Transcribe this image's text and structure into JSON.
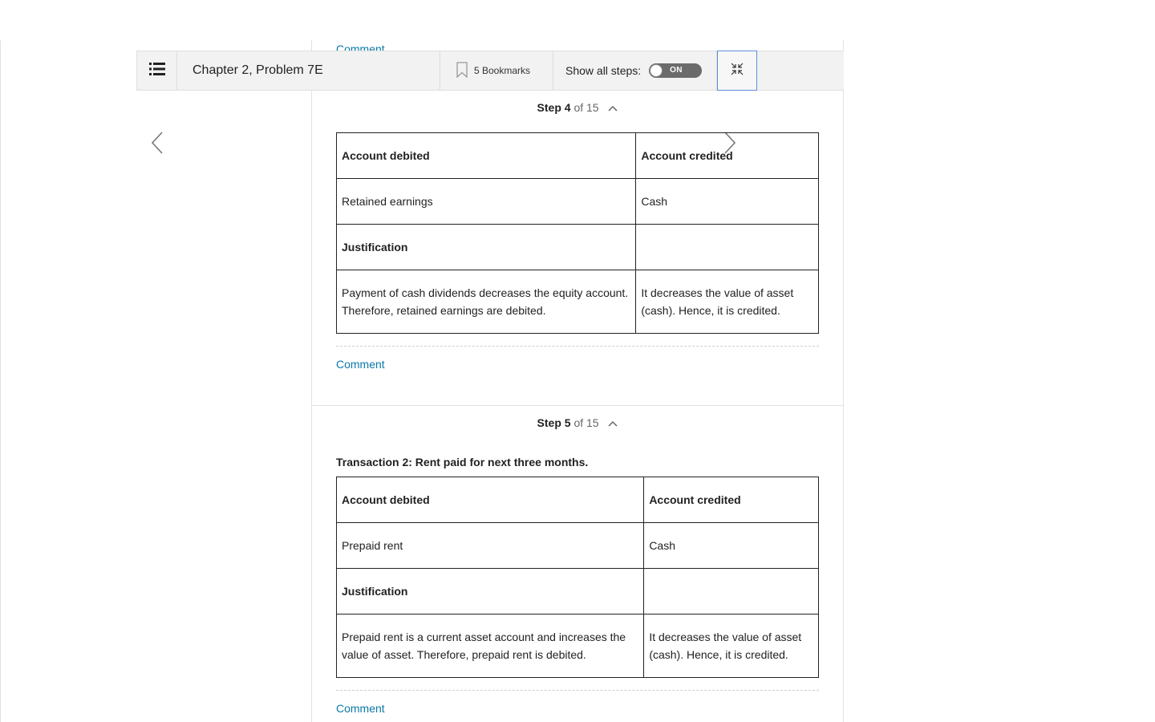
{
  "toolbar": {
    "title": "Chapter 2, Problem 7E",
    "bookmarks_label": "5 Bookmarks",
    "show_all_steps_label": "Show all steps:",
    "toggle_label": "ON"
  },
  "top_comment": "Comment",
  "steps": [
    {
      "step_label": "Step 4",
      "of_label": "of 15",
      "table": {
        "header_debited": "Account debited",
        "header_credited": "Account credited",
        "debited": "Retained earnings",
        "credited": "Cash",
        "justification_header": "Justification",
        "justification_debit": "Payment of cash dividends decreases the equity account. Therefore, retained earnings are debited.",
        "justification_credit": "It decreases the value of asset (cash). Hence, it is credited."
      },
      "comment": "Comment"
    },
    {
      "step_label": "Step 5",
      "of_label": "of 15",
      "transaction_title": "Transaction 2: Rent paid for next three months.",
      "table": {
        "header_debited": "Account debited",
        "header_credited": "Account credited",
        "debited": "Prepaid rent",
        "credited": "Cash",
        "justification_header": "Justification",
        "justification_debit": "Prepaid rent is a current asset account and increases the value of asset. Therefore, prepaid rent is debited.",
        "justification_credit": "It decreases the value of asset (cash). Hence, it is credited."
      },
      "comment": "Comment"
    }
  ],
  "icons": {
    "menu": "list-icon",
    "bookmark": "bookmark-icon",
    "collapse": "collapse-icon",
    "prev": "chevron-left-icon",
    "next": "chevron-right-icon",
    "step_toggle": "chevron-up-icon"
  },
  "colors": {
    "link": "#0a7aa8",
    "toolbar_bg": "#f2f2f2",
    "toggle_bg": "#6b6b6b",
    "focus_border": "#5b8fd9"
  }
}
